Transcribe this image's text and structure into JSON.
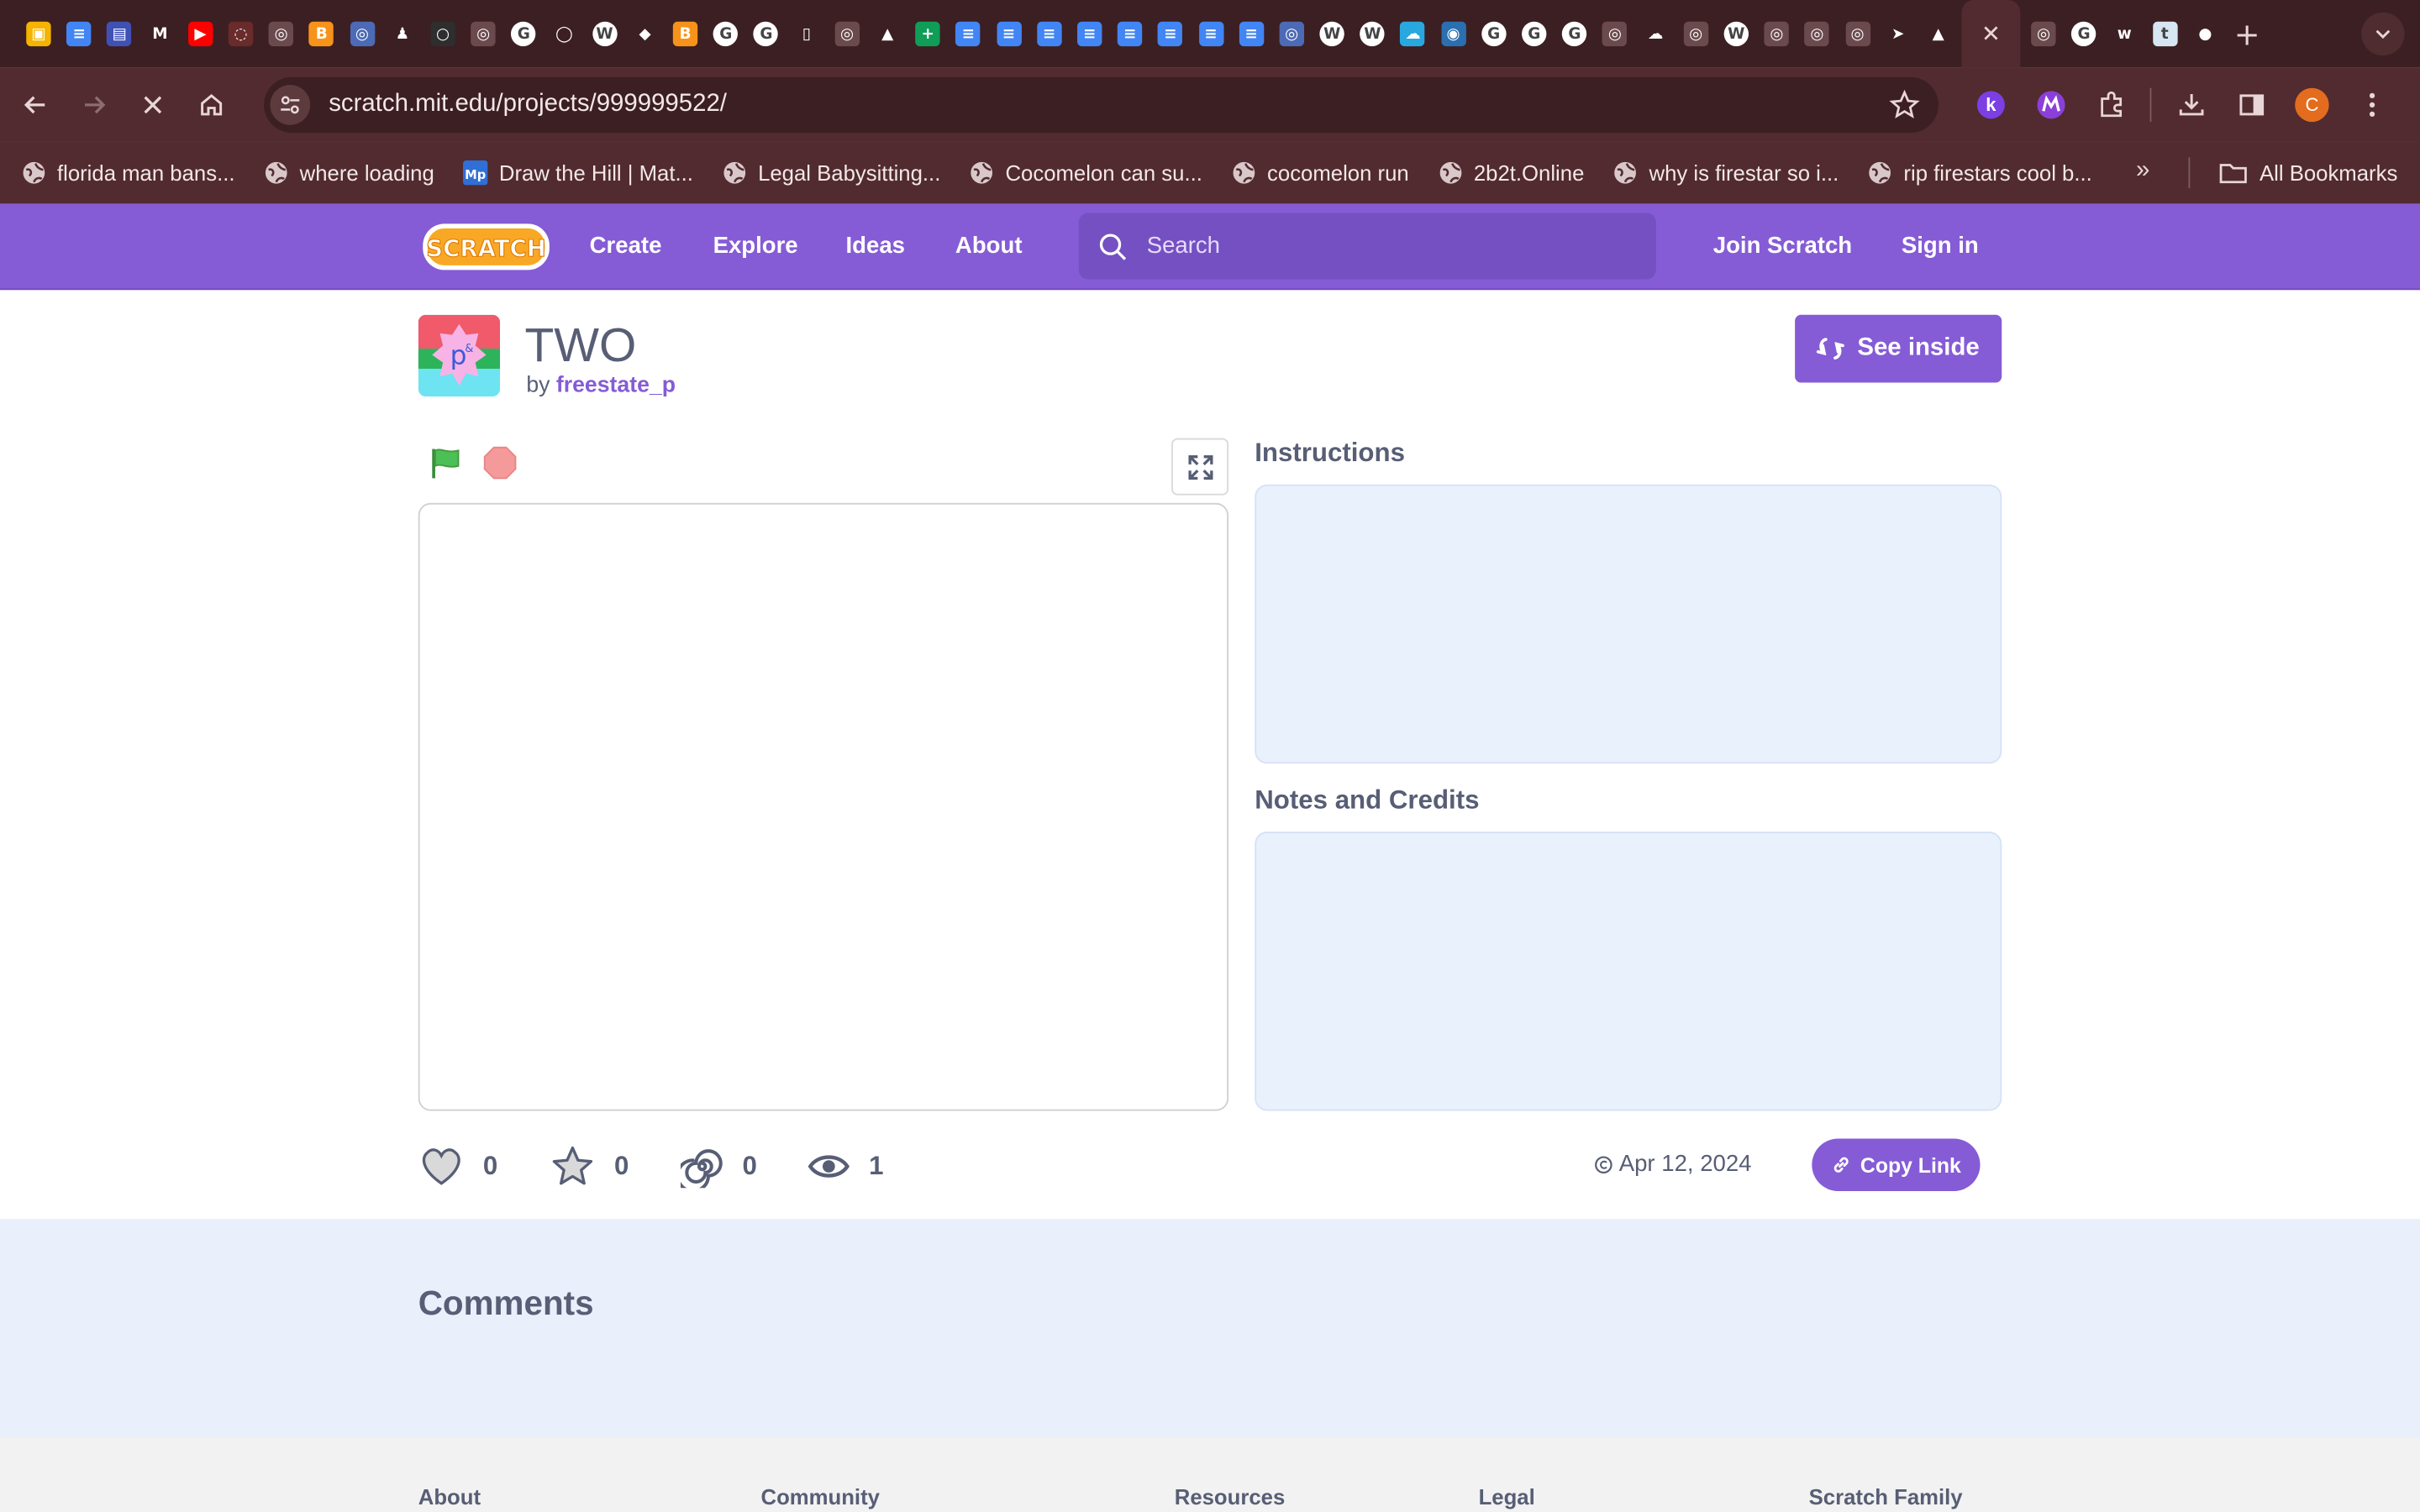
{
  "browser": {
    "url": "scratch.mit.edu/projects/999999522/",
    "profile_initial": "C",
    "tab_favicons": [
      {
        "name": "classroom-icon",
        "bg": "#f4b400",
        "glyph": "▣"
      },
      {
        "name": "docs-icon",
        "bg": "#4285f4",
        "glyph": "≡"
      },
      {
        "name": "forms-icon",
        "bg": "#3f51b5",
        "glyph": "▤"
      },
      {
        "name": "gmail-icon",
        "bg": "#3c1f22",
        "glyph": "M"
      },
      {
        "name": "youtube-icon",
        "bg": "#ff0000",
        "glyph": "▶"
      },
      {
        "name": "dotted-circle-icon",
        "bg": "#6a2b2b",
        "glyph": "◌"
      },
      {
        "name": "globe-icon",
        "bg": "#6b4a4e",
        "glyph": "◎"
      },
      {
        "name": "bitcoin-icon",
        "bg": "#f7931a",
        "glyph": "B"
      },
      {
        "name": "globe-icon",
        "bg": "#4c6ab5",
        "glyph": "◎"
      },
      {
        "name": "chess-icon",
        "bg": "#3c1f22",
        "glyph": "♟"
      },
      {
        "name": "circle-icon",
        "bg": "#2e2e2e",
        "glyph": "○"
      },
      {
        "name": "globe-icon",
        "bg": "#6b4a4e",
        "glyph": "◎"
      },
      {
        "name": "google-icon",
        "bg": "#ffffff",
        "glyph": "G"
      },
      {
        "name": "speech-icon",
        "bg": "#3c1f22",
        "glyph": "◯"
      },
      {
        "name": "wikipedia-icon",
        "bg": "#ffffff",
        "glyph": "W"
      },
      {
        "name": "diamond-icon",
        "bg": "#3c1f22",
        "glyph": "◆"
      },
      {
        "name": "bitcoin-icon",
        "bg": "#f7931a",
        "glyph": "B"
      },
      {
        "name": "google-icon",
        "bg": "#ffffff",
        "glyph": "G"
      },
      {
        "name": "google-icon",
        "bg": "#ffffff",
        "glyph": "G"
      },
      {
        "name": "mouse-icon",
        "bg": "#3c1f22",
        "glyph": "▯"
      },
      {
        "name": "globe-icon",
        "bg": "#6b4a4e",
        "glyph": "◎"
      },
      {
        "name": "drive-icon",
        "bg": "#3c1f22",
        "glyph": "▲"
      },
      {
        "name": "sheets-icon",
        "bg": "#0f9d58",
        "glyph": "+"
      },
      {
        "name": "docs-icon",
        "bg": "#4285f4",
        "glyph": "≡"
      },
      {
        "name": "docs-icon",
        "bg": "#4285f4",
        "glyph": "≡"
      },
      {
        "name": "docs-icon",
        "bg": "#4285f4",
        "glyph": "≡"
      },
      {
        "name": "docs-icon",
        "bg": "#4285f4",
        "glyph": "≡"
      },
      {
        "name": "docs-icon",
        "bg": "#4285f4",
        "glyph": "≡"
      },
      {
        "name": "docs-icon",
        "bg": "#4285f4",
        "glyph": "≡"
      },
      {
        "name": "docs-icon",
        "bg": "#4285f4",
        "glyph": "≡"
      },
      {
        "name": "docs-icon",
        "bg": "#4285f4",
        "glyph": "≡"
      },
      {
        "name": "globe-icon",
        "bg": "#4c6ab5",
        "glyph": "◎"
      },
      {
        "name": "wikipedia-icon",
        "bg": "#ffffff",
        "glyph": "W"
      },
      {
        "name": "wikipedia-icon",
        "bg": "#ffffff",
        "glyph": "W"
      },
      {
        "name": "cloud-icon",
        "bg": "#29a8e0",
        "glyph": "☁"
      },
      {
        "name": "earth-icon",
        "bg": "#2a6fb0",
        "glyph": "◉"
      },
      {
        "name": "google-icon",
        "bg": "#ffffff",
        "glyph": "G"
      },
      {
        "name": "google-icon",
        "bg": "#ffffff",
        "glyph": "G"
      },
      {
        "name": "google-icon",
        "bg": "#ffffff",
        "glyph": "G"
      },
      {
        "name": "globe-icon",
        "bg": "#6b4a4e",
        "glyph": "◎"
      },
      {
        "name": "cloud-icon",
        "bg": "#3c1f22",
        "glyph": "☁"
      },
      {
        "name": "globe-icon",
        "bg": "#6b4a4e",
        "glyph": "◎"
      },
      {
        "name": "wikipedia-icon",
        "bg": "#ffffff",
        "glyph": "W"
      },
      {
        "name": "globe-icon",
        "bg": "#6b4a4e",
        "glyph": "◎"
      },
      {
        "name": "globe-icon",
        "bg": "#6b4a4e",
        "glyph": "◎"
      },
      {
        "name": "globe-icon",
        "bg": "#6b4a4e",
        "glyph": "◎"
      },
      {
        "name": "send-icon",
        "bg": "#3c1f22",
        "glyph": "➤"
      },
      {
        "name": "onigiri-icon",
        "bg": "#3c1f22",
        "glyph": "▲"
      }
    ],
    "tab_favicons_after": [
      {
        "name": "globe-icon",
        "bg": "#6b4a4e",
        "glyph": "◎"
      },
      {
        "name": "google-icon",
        "bg": "#ffffff",
        "glyph": "G"
      },
      {
        "name": "wu-icon",
        "bg": "#3c1f22",
        "glyph": "w"
      },
      {
        "name": "tumblr-icon",
        "bg": "#d6e6f2",
        "glyph": "t"
      },
      {
        "name": "rainbow-icon",
        "bg": "#3c1f22",
        "glyph": "●"
      }
    ],
    "bookmarks": [
      {
        "label": "florida man bans...",
        "icon": "globe-icon"
      },
      {
        "label": "where loading",
        "icon": "globe-icon"
      },
      {
        "label": "Draw the Hill | Mat...",
        "icon": "mp-icon"
      },
      {
        "label": "Legal Babysitting...",
        "icon": "globe-icon"
      },
      {
        "label": "Cocomelon can su...",
        "icon": "globe-icon"
      },
      {
        "label": "cocomelon run",
        "icon": "globe-icon"
      },
      {
        "label": "2b2t.Online",
        "icon": "globe-icon"
      },
      {
        "label": "why is firestar so i...",
        "icon": "globe-icon"
      },
      {
        "label": "rip firestars cool b...",
        "icon": "globe-icon"
      }
    ],
    "all_bookmarks_label": "All Bookmarks"
  },
  "nav": {
    "create": "Create",
    "explore": "Explore",
    "ideas": "Ideas",
    "about": "About",
    "search_placeholder": "Search",
    "join": "Join Scratch",
    "signin": "Sign in"
  },
  "project": {
    "title": "TWO",
    "by_prefix": "by",
    "author": "freestate_p",
    "see_inside": "See inside",
    "instructions_title": "Instructions",
    "notes_title": "Notes and Credits",
    "loves": "0",
    "favorites": "0",
    "remixes": "0",
    "views": "1",
    "date": "Apr 12, 2024",
    "copy_link": "Copy Link"
  },
  "comments": {
    "title": "Comments"
  },
  "footer": {
    "cols": [
      "About",
      "Community",
      "Resources",
      "Legal",
      "Scratch Family"
    ]
  },
  "colors": {
    "scratch_purple": "#855cd6",
    "chrome_dark": "#3c1f22",
    "chrome_mid": "#512b2f",
    "text": "#575e75",
    "panel_blue": "#e9f1fc"
  }
}
